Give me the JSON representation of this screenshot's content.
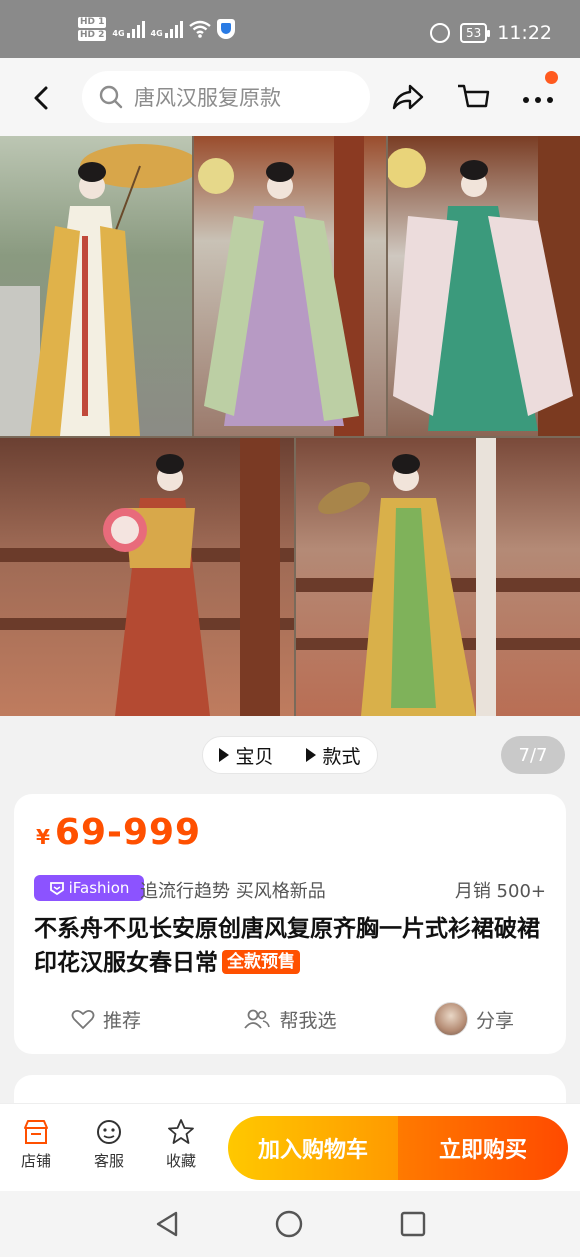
{
  "status_bar": {
    "hd1": "HD 1",
    "hd2": "HD 2",
    "sig1": "4G",
    "sig2": "4G",
    "battery": "53",
    "time": "11:22"
  },
  "nav": {
    "search_placeholder": "唐风汉服复原款"
  },
  "gallery": {
    "tab_item": "宝贝",
    "tab_style": "款式",
    "page_indicator": "7/7"
  },
  "product": {
    "currency": "¥",
    "price": "69-999",
    "badge": "iFashion",
    "slogan": "追流行趋势 买风格新品",
    "sales": "月销  500+",
    "title": "不系舟不见长安原创唐风复原齐胸一片式衫裙破裙印花汉服女春日常",
    "presale_tag": "全款预售",
    "action_recommend": "推荐",
    "action_help": "帮我选",
    "action_share": "分享"
  },
  "bottom_bar": {
    "shop": "店铺",
    "service": "客服",
    "favorite": "收藏",
    "add_cart": "加入购物车",
    "buy_now": "立即购买"
  }
}
